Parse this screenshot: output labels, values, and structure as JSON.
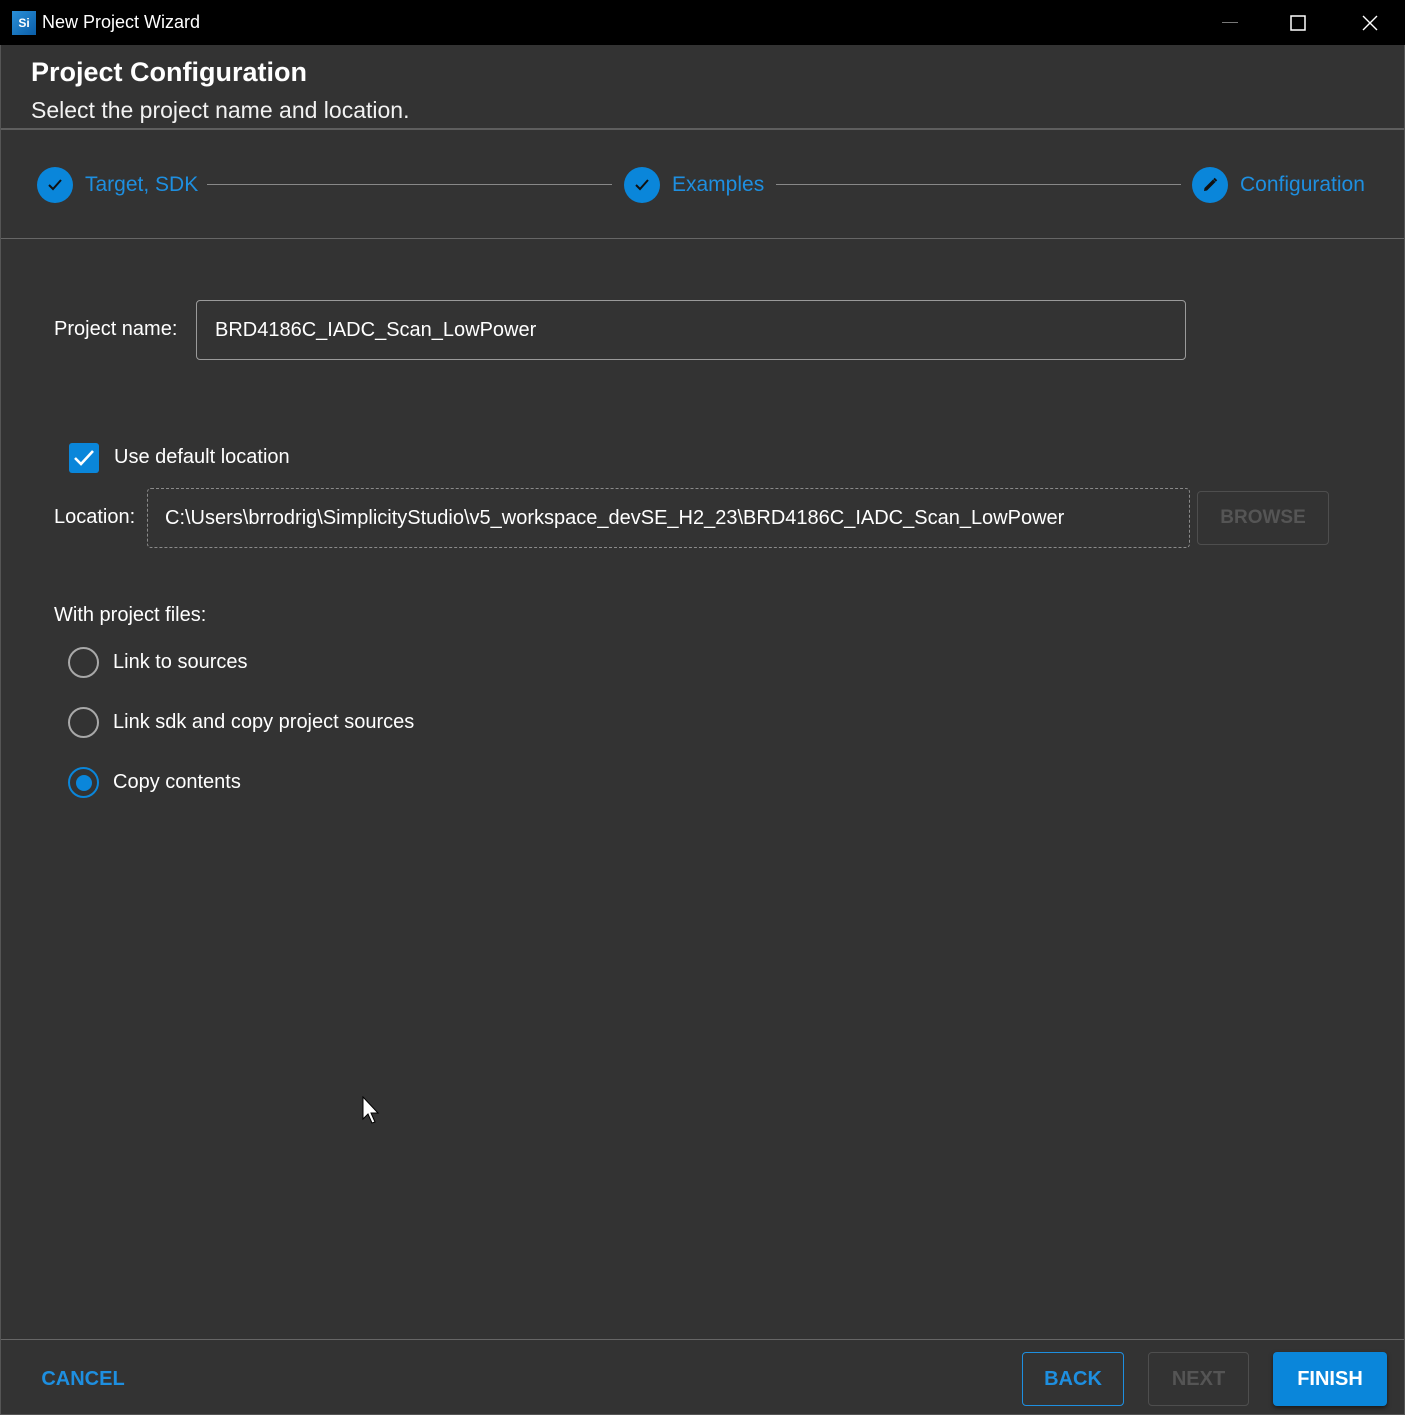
{
  "window": {
    "title": "New Project Wizard",
    "app_icon_text": "Si"
  },
  "header": {
    "title": "Project Configuration",
    "subtitle": "Select the project name and location."
  },
  "stepper": {
    "steps": [
      {
        "label": "Target, SDK",
        "state": "completed",
        "icon": "check-icon"
      },
      {
        "label": "Examples",
        "state": "completed",
        "icon": "check-icon"
      },
      {
        "label": "Configuration",
        "state": "active",
        "icon": "pencil-icon"
      }
    ]
  },
  "form": {
    "project_name_label": "Project name:",
    "project_name_value": "BRD4186C_IADC_Scan_LowPower",
    "use_default_location_label": "Use default location",
    "use_default_location_checked": true,
    "location_label": "Location:",
    "location_value": "C:\\Users\\brrodrig\\SimplicityStudio\\v5_workspace_devSE_H2_23\\BRD4186C_IADC_Scan_LowPower",
    "browse_label": "BROWSE",
    "files_label": "With project files:",
    "file_options": [
      {
        "label": "Link to sources",
        "selected": false
      },
      {
        "label": "Link sdk and copy project sources",
        "selected": false
      },
      {
        "label": "Copy contents",
        "selected": true
      }
    ]
  },
  "footer": {
    "cancel_label": "CANCEL",
    "back_label": "BACK",
    "next_label": "NEXT",
    "finish_label": "FINISH"
  },
  "colors": {
    "accent": "#0a86da",
    "background": "#333333",
    "titlebar": "#000000"
  }
}
